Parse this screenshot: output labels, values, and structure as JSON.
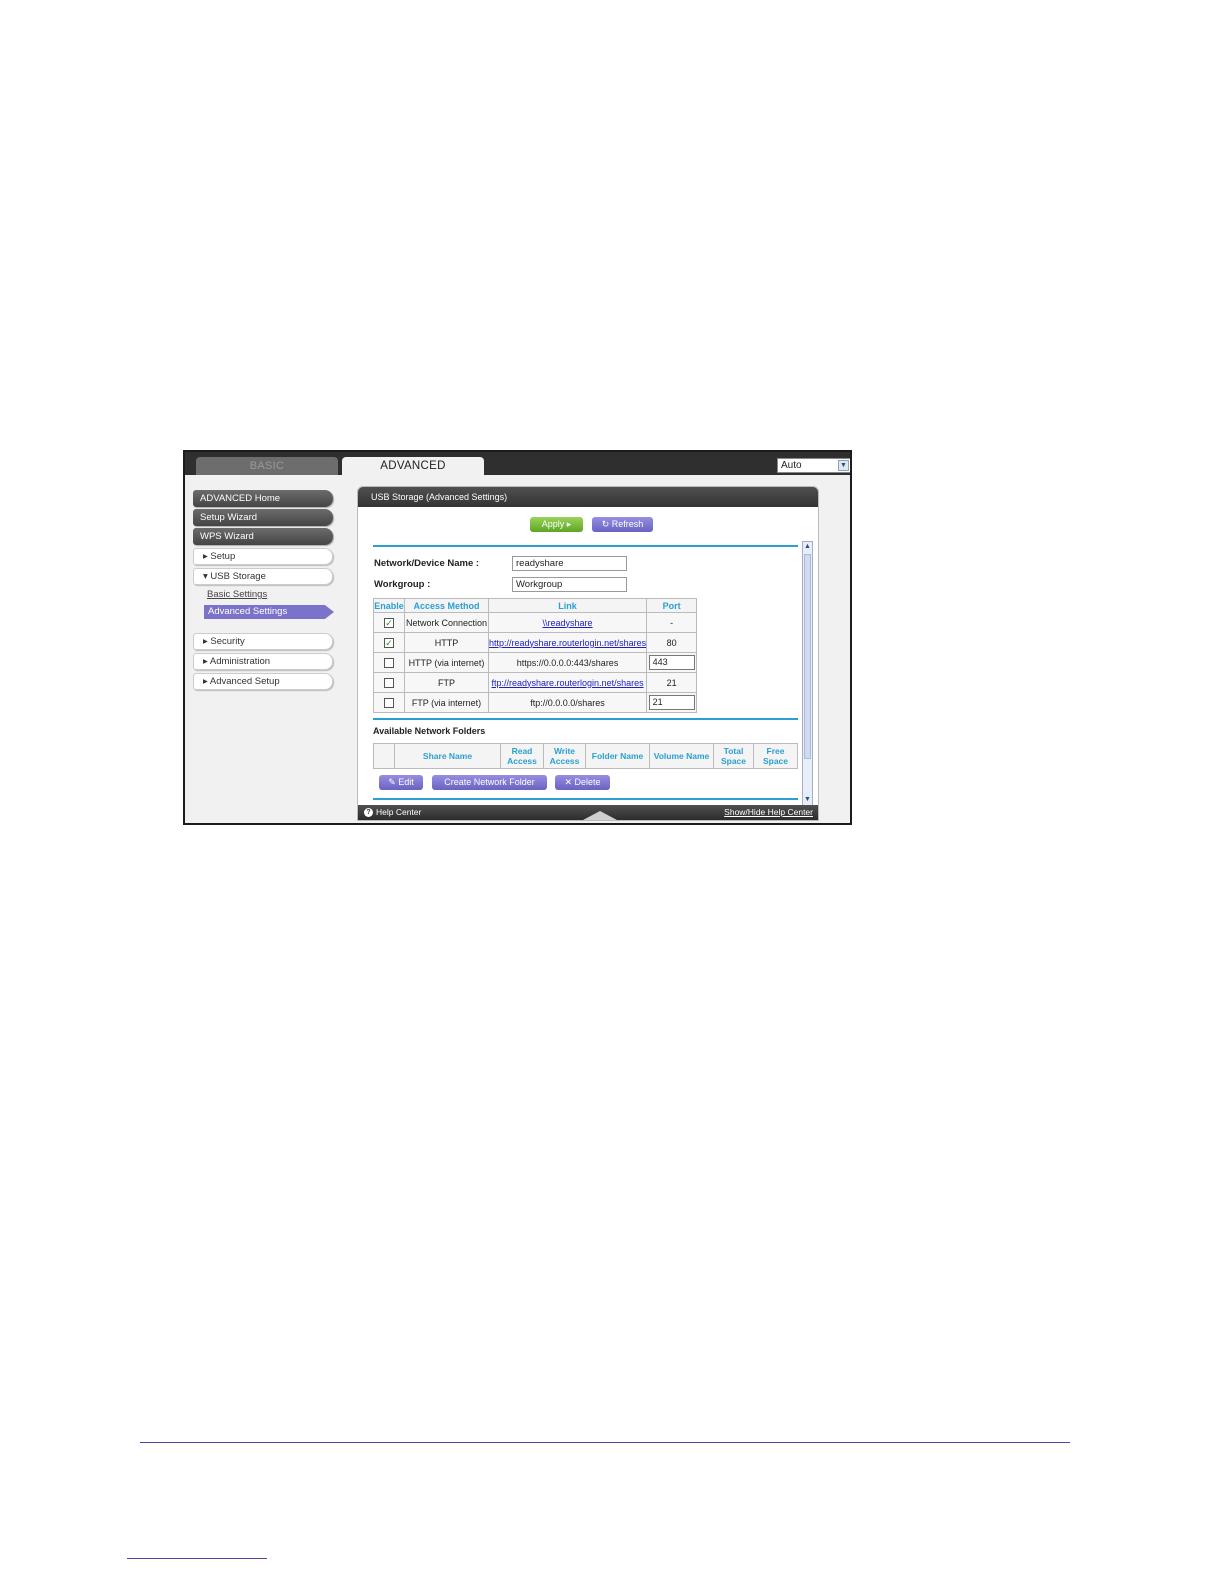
{
  "tabs": {
    "basic": "BASIC",
    "advanced": "ADVANCED"
  },
  "mode_select": {
    "value": "Auto"
  },
  "sidebar": {
    "advanced_home": "ADVANCED Home",
    "setup_wizard": "Setup Wizard",
    "wps_wizard": "WPS Wizard",
    "setup": "▸ Setup",
    "usb_storage": "▾ USB Storage",
    "basic_settings": "Basic Settings",
    "advanced_settings": "Advanced Settings",
    "security": "▸ Security",
    "administration": "▸ Administration",
    "advanced_setup": "▸ Advanced Setup"
  },
  "panel": {
    "title": "USB Storage (Advanced Settings)",
    "apply": "Apply ▸",
    "refresh": "↻ Refresh",
    "device_name_label": "Network/Device Name :",
    "device_name_value": "readyshare",
    "workgroup_label": "Workgroup :",
    "workgroup_value": "Workgroup"
  },
  "access_table": {
    "headers": [
      "Enable",
      "Access Method",
      "Link",
      "Port"
    ],
    "rows": [
      {
        "checked": "✓",
        "method": "Network Connection",
        "link": "\\\\readyshare",
        "port": "-"
      },
      {
        "checked": "✓",
        "method": "HTTP",
        "link": "http://readyshare.routerlogin.net/shares",
        "port": "80"
      },
      {
        "checked": "",
        "method": "HTTP (via internet)",
        "link": "https://0.0.0.0:443/shares",
        "port": "443"
      },
      {
        "checked": "",
        "method": "FTP",
        "link": "ftp://readyshare.routerlogin.net/shares",
        "port": "21"
      },
      {
        "checked": "",
        "method": "FTP (via internet)",
        "link": "ftp://0.0.0.0/shares",
        "port": "21"
      }
    ]
  },
  "folders": {
    "title": "Available Network Folders",
    "headers": [
      "Share Name",
      "Read Access",
      "Write Access",
      "Folder Name",
      "Volume Name",
      "Total Space",
      "Free Space"
    ],
    "edit": "✎ Edit",
    "create": "Create Network Folder",
    "delete": "✕ Delete"
  },
  "helpbar": {
    "icon": "?",
    "label": "Help Center",
    "toggle": "Show/Hide Help Center"
  }
}
